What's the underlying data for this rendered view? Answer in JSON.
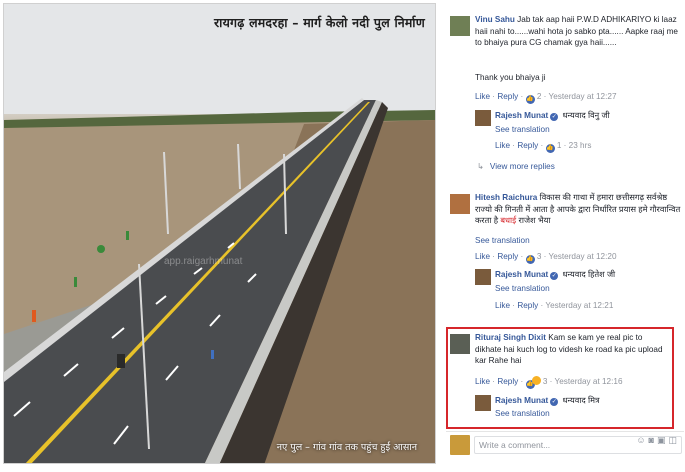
{
  "photo": {
    "title": "रायगढ़ लमदरहा – मार्ग केलो नदी पुल निर्माण",
    "caption": "नए पुल – गांव गांव तक पहुंच हुई आसान",
    "watermark": "app.raigarhmunat"
  },
  "comments": [
    {
      "author": "Vinu Sahu",
      "text": "Jab tak aap haii P.W.D ADHIKARIYO ki laaz haii nahi to......wahi hota jo sabko pta...... Aapke raaj me to bhaiya pura CG chamak gya haii......",
      "text2": "Thank you bhaiya ji",
      "actions": {
        "like": "Like",
        "reply": "Reply",
        "count": "2",
        "time": "Yesterday at 12:27"
      },
      "reply": {
        "author": "Rajesh Munat",
        "text": "धन्यवाद विनु जी",
        "see_translation": "See translation",
        "actions": {
          "like": "Like",
          "reply": "Reply",
          "count": "1",
          "time": "23 hrs"
        }
      },
      "view_more": "View more replies"
    },
    {
      "author": "Hitesh Raichura",
      "text": "विकास की गाथा में हमारा छत्तीसगढ़ सर्वश्रेष्ठ राज्यो की गिनती में आता है आपके द्वारा निर्धारित प्रयास हमे गौरवान्वित करता है",
      "text_highlight": "बधाई",
      "text_end": "राजेश भैया",
      "see_translation": "See translation",
      "actions": {
        "like": "Like",
        "reply": "Reply",
        "count": "3",
        "time": "Yesterday at 12:20"
      },
      "reply": {
        "author": "Rajesh Munat",
        "text": "धन्यवाद हितेश जी",
        "see_translation": "See translation",
        "actions": {
          "like": "Like",
          "reply": "Reply",
          "time": "Yesterday at 12:21"
        }
      }
    },
    {
      "author": "Rituraj Singh Dixit",
      "text": "Kam se kam ye real pic to dikhate hai kuch log to videsh ke road ka pic upload kar Rahe hai",
      "actions": {
        "like": "Like",
        "reply": "Reply",
        "count": "3",
        "time": "Yesterday at 12:16"
      },
      "reply": {
        "author": "Rajesh Munat",
        "text": "धन्यवाद मित्र",
        "see_translation": "See translation"
      }
    }
  ],
  "write_comment": {
    "placeholder": "Write a comment..."
  },
  "colors": {
    "link": "#365899",
    "highlight_border": "#d6262b",
    "like_badge": "#4267b2"
  }
}
